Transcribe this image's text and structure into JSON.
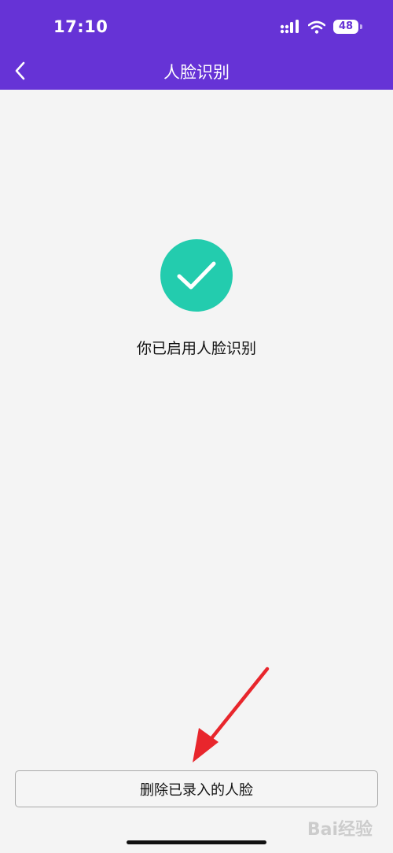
{
  "status_bar": {
    "time": "17:10",
    "battery": "48",
    "signal_icon": "cellular-signal-icon",
    "wifi_icon": "wifi-icon"
  },
  "nav": {
    "title": "人脸识别",
    "back_icon": "chevron-left-icon"
  },
  "main": {
    "success_icon": "checkmark-icon",
    "message": "你已启用人脸识别"
  },
  "footer": {
    "delete_button_label": "删除已录入的人脸"
  },
  "annotation": {
    "arrow_color": "#e8262c"
  },
  "watermark": {
    "text": "Bai经验"
  },
  "colors": {
    "header_bg": "#6633d6",
    "success_green": "#23ccae",
    "page_bg": "#f4f4f4"
  }
}
